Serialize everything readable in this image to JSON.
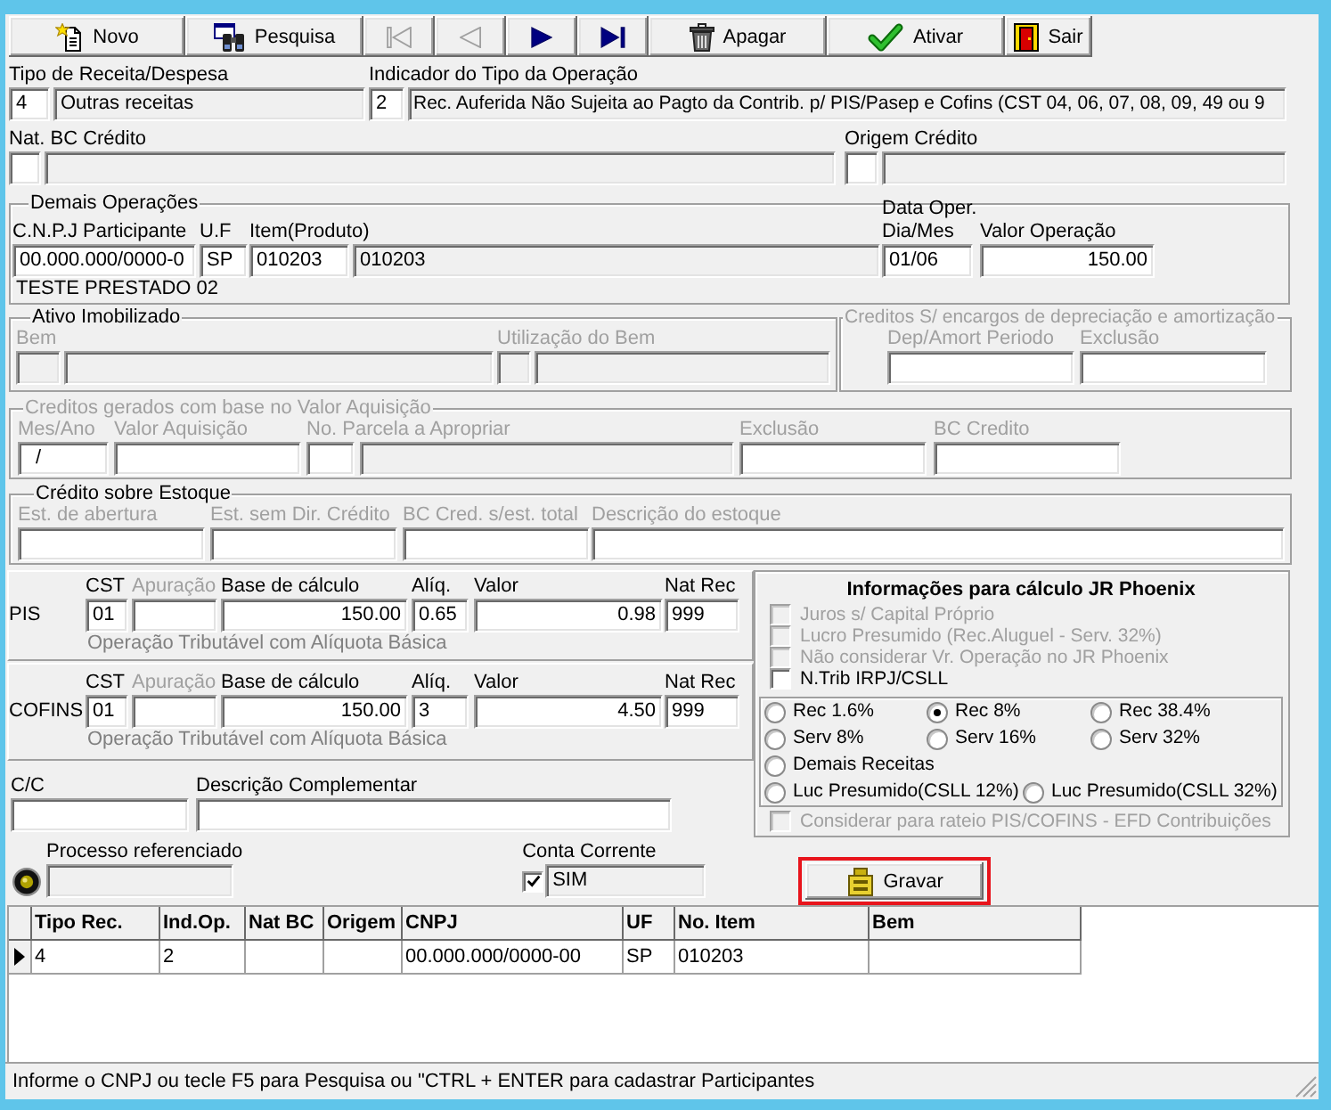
{
  "toolbar": [
    {
      "kind": "new",
      "label": "Novo",
      "disabled": false
    },
    {
      "kind": "search",
      "label": "Pesquisa",
      "disabled": false
    },
    {
      "kind": "first",
      "disabled": true
    },
    {
      "kind": "previous",
      "disabled": true
    },
    {
      "kind": "next",
      "disabled": false
    },
    {
      "kind": "last",
      "disabled": false
    },
    {
      "kind": "delete",
      "label": "Apagar",
      "disabled": false
    },
    {
      "kind": "activate",
      "label": "Ativar",
      "disabled": false
    },
    {
      "kind": "exit",
      "label": "Sair",
      "disabled": false
    }
  ],
  "operation_rows": [
    [
      {
        "label": "Tipo de Receita/Despesa",
        "disabled": false,
        "inputs": [
          {
            "value": "4",
            "readonly": false
          },
          {
            "value": "Outras receitas",
            "readonly": true
          }
        ]
      },
      {
        "label": "Indicador do Tipo da Operação",
        "disabled": false,
        "inputs": [
          {
            "value": "2",
            "readonly": false
          },
          {
            "value": "Rec. Auferida Não Sujeita ao Pagto da Contrib. p/ PIS/Pasep e Cofins (CST 04, 06, 07, 08, 09, 49 ou 9",
            "readonly": true
          }
        ]
      }
    ],
    [
      {
        "label": "Nat. BC Crédito",
        "disabled": false,
        "inputs": [
          {
            "readonly": false
          },
          {
            "readonly": true
          }
        ]
      },
      {
        "label": "Origem Crédito",
        "disabled": false,
        "inputs": [
          {
            "readonly": false
          },
          {
            "readonly": true
          }
        ]
      }
    ]
  ],
  "demais_operacoes": {
    "title": "Demais Operações",
    "disabled": false,
    "fields": [
      {
        "label": "C.N.P.J Participante",
        "disabled": false,
        "inputs": [
          {
            "value": "00.000.000/0000-0",
            "readonly": false
          }
        ]
      },
      {
        "label": "U.F",
        "disabled": false,
        "inputs": [
          {
            "value": "SP",
            "readonly": false
          }
        ]
      },
      {
        "label": "Item(Produto)",
        "disabled": false,
        "inputs": [
          {
            "value": "010203",
            "readonly": false
          },
          {
            "value": "010203",
            "readonly": true
          }
        ]
      },
      {
        "label": "Data Oper. Dia/Mes",
        "disabled": false,
        "inputs": [
          {
            "value": "01/06",
            "readonly": false
          }
        ]
      },
      {
        "label": "Valor Operação",
        "disabled": false,
        "inputs": [
          {
            "value": "150.00",
            "readonly": false
          }
        ]
      }
    ],
    "participant": "TESTE PRESTADO 02"
  },
  "ativo_imobilizado": {
    "title": "Ativo Imobilizado",
    "disabled": false,
    "fields": [
      {
        "label": "Bem",
        "disabled": true,
        "inputs": [
          {
            "readonly": true
          },
          {
            "readonly": true
          }
        ]
      },
      {
        "label": "Utilização do Bem",
        "disabled": true,
        "inputs": [
          {
            "readonly": true
          },
          {
            "readonly": true
          }
        ]
      }
    ]
  },
  "creditos_encargos": {
    "title": "Creditos S/ encargos de depreciação e amortização",
    "disabled": true,
    "fields": [
      {
        "label": "Dep/Amort Periodo",
        "disabled": true,
        "inputs": [
          {
            "readonly": false
          }
        ]
      },
      {
        "label": "Exclusão",
        "disabled": true,
        "inputs": [
          {
            "readonly": false
          }
        ]
      }
    ]
  },
  "creditos_aquisicao": {
    "title": "Creditos gerados com base no Valor Aquisição",
    "disabled": true,
    "fields": [
      {
        "label": "Mes/Ano",
        "disabled": true,
        "inputs": [
          {
            "value": "/",
            "readonly": false
          }
        ]
      },
      {
        "label": "Valor Aquisição",
        "disabled": true,
        "inputs": [
          {
            "readonly": false
          }
        ]
      },
      {
        "label": "No. Parcela a Apropriar",
        "disabled": true,
        "inputs": [
          {
            "readonly": false
          },
          {
            "readonly": true
          }
        ]
      },
      {
        "label": "Exclusão",
        "disabled": true,
        "inputs": [
          {
            "readonly": false
          }
        ]
      },
      {
        "label": "BC Credito",
        "disabled": true,
        "inputs": [
          {
            "readonly": false
          }
        ]
      }
    ]
  },
  "credito_estoque": {
    "title": "Crédito sobre Estoque",
    "disabled": false,
    "fields": [
      {
        "label": "Est. de abertura",
        "disabled": true,
        "inputs": [
          {
            "readonly": false
          }
        ]
      },
      {
        "label": "Est. sem Dir. Crédito",
        "disabled": true,
        "inputs": [
          {
            "readonly": false
          }
        ]
      },
      {
        "label": "BC Cred. s/est. total",
        "disabled": true,
        "inputs": [
          {
            "readonly": false
          }
        ]
      },
      {
        "label": "Descrição do estoque",
        "disabled": true,
        "inputs": [
          {
            "readonly": false
          }
        ]
      }
    ]
  },
  "taxes": [
    {
      "name": "PIS",
      "fields": [
        {
          "label": "CST",
          "disabled": false,
          "inputs": [
            {
              "value": "01",
              "readonly": false
            }
          ]
        },
        {
          "label": "Apuração",
          "disabled": true,
          "inputs": [
            {
              "readonly": false
            }
          ]
        },
        {
          "label": "Base de cálculo",
          "disabled": false,
          "inputs": [
            {
              "value": "150.00",
              "readonly": false
            }
          ]
        },
        {
          "label": "Alíq.",
          "disabled": false,
          "inputs": [
            {
              "value": "0.65",
              "readonly": false
            }
          ]
        },
        {
          "label": "Valor",
          "disabled": false,
          "inputs": [
            {
              "value": "0.98",
              "readonly": false
            }
          ]
        },
        {
          "label": "Nat Rec",
          "disabled": false,
          "inputs": [
            {
              "value": "999",
              "readonly": false
            }
          ]
        }
      ],
      "note": "Operação Tributável com Alíquota Básica"
    },
    {
      "name": "COFINS",
      "fields": [
        {
          "label": "CST",
          "disabled": false,
          "inputs": [
            {
              "value": "01",
              "readonly": false
            }
          ]
        },
        {
          "label": "Apuração",
          "disabled": true,
          "inputs": [
            {
              "readonly": false
            }
          ]
        },
        {
          "label": "Base de cálculo",
          "disabled": false,
          "inputs": [
            {
              "value": "150.00",
              "readonly": false
            }
          ]
        },
        {
          "label": "Alíq.",
          "disabled": false,
          "inputs": [
            {
              "value": "3",
              "readonly": false
            }
          ]
        },
        {
          "label": "Valor",
          "disabled": false,
          "inputs": [
            {
              "value": "4.50",
              "readonly": false
            }
          ]
        },
        {
          "label": "Nat Rec",
          "disabled": false,
          "inputs": [
            {
              "value": "999",
              "readonly": false
            }
          ]
        }
      ],
      "note": "Operação Tributável com Alíquota Básica"
    }
  ],
  "complement_fields": [
    {
      "label": "C/C",
      "disabled": false,
      "inputs": [
        {
          "readonly": false
        }
      ]
    },
    {
      "label": "Descrição Complementar",
      "disabled": false,
      "inputs": [
        {
          "readonly": false
        }
      ]
    }
  ],
  "jr_phoenix": {
    "title": "Informações para cálculo JR Phoenix",
    "options": [
      {
        "label": "Juros s/ Capital Próprio",
        "checked": false,
        "disabled": true
      },
      {
        "label": "Lucro Presumido (Rec.Aluguel - Serv. 32%)",
        "checked": false,
        "disabled": true
      },
      {
        "label": "Não considerar Vr. Operação no JR Phoenix",
        "checked": false,
        "disabled": true
      },
      {
        "label": "N.Trib IRPJ/CSLL",
        "checked": false,
        "disabled": false
      }
    ],
    "regimes": [
      {
        "label": "Rec 1.6%",
        "selected": false
      },
      {
        "label": "Rec 8%",
        "selected": true
      },
      {
        "label": "Rec 38.4%",
        "selected": false
      },
      {
        "label": "Serv 8%",
        "selected": false
      },
      {
        "label": "Serv 16%",
        "selected": false
      },
      {
        "label": "Serv 32%",
        "selected": false
      },
      {
        "label": "Demais Receitas",
        "selected": false
      },
      {
        "label": "Luc Presumido(CSLL 12%)",
        "selected": false
      },
      {
        "label": "Luc Presumido(CSLL 32%)",
        "selected": false
      }
    ],
    "rateio_option": {
      "label": "Considerar para rateio PIS/COFINS - EFD Contribuições",
      "checked": false,
      "disabled": true
    }
  },
  "processo_referenciado": {
    "label": "Processo referenciado",
    "readonly": true
  },
  "conta_corrente": {
    "label": "Conta Corrente",
    "checked": true,
    "value": "SIM",
    "readonly": true
  },
  "save_button": {
    "label": "Gravar",
    "highlighted": true
  },
  "grid": {
    "columns": [
      "Tipo Rec.",
      "Ind.Op.",
      "Nat BC",
      "Origem",
      "CNPJ",
      "UF",
      "No. Item",
      "Bem"
    ],
    "rows": [
      {
        "current": true,
        "cells": [
          "4",
          "2",
          null,
          null,
          "00.000.000/0000-00",
          "SP",
          "010203",
          null
        ]
      }
    ]
  },
  "status_bar": {
    "message": "Informe o CNPJ ou tecle F5 para Pesquisa ou \"CTRL + ENTER para cadastrar Participantes"
  }
}
